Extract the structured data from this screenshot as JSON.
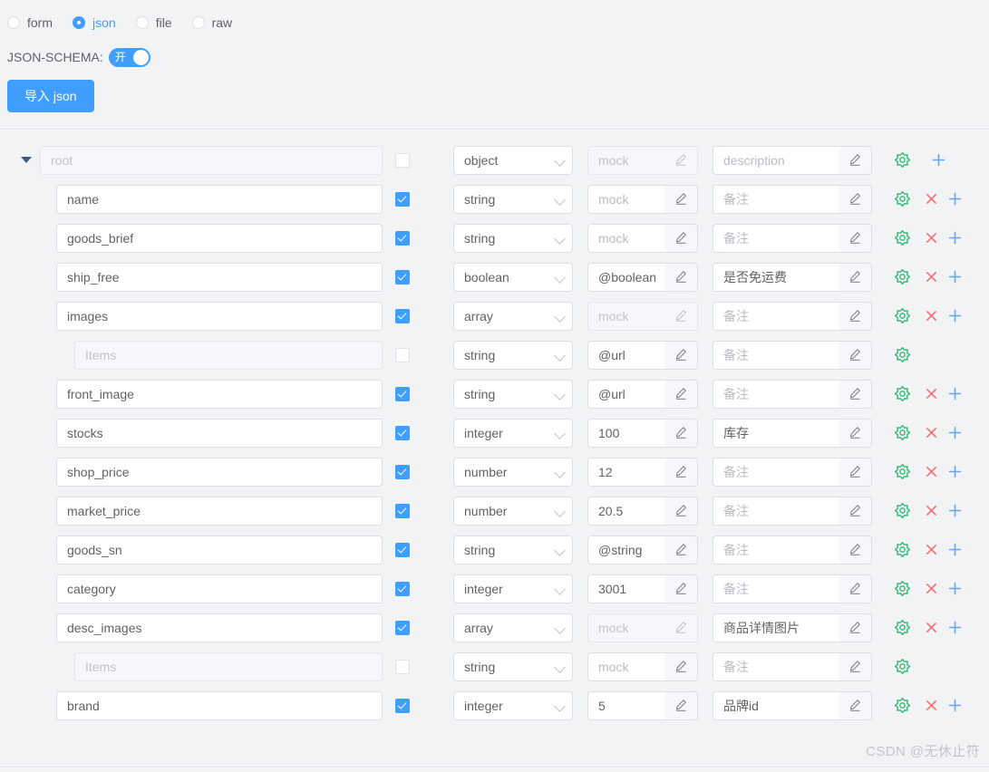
{
  "mode_radios": [
    {
      "label": "form",
      "checked": false
    },
    {
      "label": "json",
      "checked": true
    },
    {
      "label": "file",
      "checked": false
    },
    {
      "label": "raw",
      "checked": false
    }
  ],
  "schema_switch": {
    "caption": "JSON-SCHEMA:",
    "state_label": "开",
    "on": true,
    "on_color": "#409eff"
  },
  "import_button": {
    "label": "导入 json",
    "color": "#409eff"
  },
  "columns": {
    "type_options": [
      "object",
      "string",
      "number",
      "integer",
      "boolean",
      "array",
      "null"
    ],
    "mock_placeholder": "mock",
    "description_placeholder_root": "description",
    "description_placeholder_child": "备注"
  },
  "icons": {
    "caret": "caret-down-icon",
    "edit": "pencil-icon",
    "settings": "gear-icon",
    "remove": "close-icon",
    "add": "plus-icon",
    "gear_color": "#2eb872",
    "remove_color": "#f56c6c",
    "add_color": "#5fa8f5"
  },
  "rows": [
    {
      "level": "root",
      "key": "root",
      "key_is_placeholder": true,
      "checked": false,
      "checkbox_disabled": true,
      "type": "object",
      "mock": "",
      "mock_placeholder": "mock",
      "mock_disabled": true,
      "desc": "",
      "desc_placeholder": "description",
      "actions": [
        "gear",
        "plus"
      ],
      "caret": true
    },
    {
      "level": "child",
      "key": "name",
      "key_is_placeholder": false,
      "checked": true,
      "checkbox_disabled": false,
      "type": "string",
      "mock": "",
      "mock_placeholder": "mock",
      "mock_disabled": false,
      "desc": "",
      "desc_placeholder": "备注",
      "actions": [
        "gear",
        "close",
        "plus"
      ],
      "caret": false
    },
    {
      "level": "child",
      "key": "goods_brief",
      "key_is_placeholder": false,
      "checked": true,
      "checkbox_disabled": false,
      "type": "string",
      "mock": "",
      "mock_placeholder": "mock",
      "mock_disabled": false,
      "desc": "",
      "desc_placeholder": "备注",
      "actions": [
        "gear",
        "close",
        "plus"
      ],
      "caret": false
    },
    {
      "level": "child",
      "key": "ship_free",
      "key_is_placeholder": false,
      "checked": true,
      "checkbox_disabled": false,
      "type": "boolean",
      "mock": "@boolean",
      "mock_placeholder": "mock",
      "mock_disabled": false,
      "desc": "是否免运费",
      "desc_placeholder": "备注",
      "actions": [
        "gear",
        "close",
        "plus"
      ],
      "caret": false
    },
    {
      "level": "child",
      "key": "images",
      "key_is_placeholder": false,
      "checked": true,
      "checkbox_disabled": false,
      "type": "array",
      "mock": "",
      "mock_placeholder": "mock",
      "mock_disabled": true,
      "desc": "",
      "desc_placeholder": "备注",
      "actions": [
        "gear",
        "close",
        "plus"
      ],
      "caret": false
    },
    {
      "level": "items",
      "key": "",
      "key_placeholder": "Items",
      "key_is_placeholder": true,
      "checked": false,
      "checkbox_disabled": true,
      "type": "string",
      "mock": "@url",
      "mock_placeholder": "mock",
      "mock_disabled": false,
      "desc": "",
      "desc_placeholder": "备注",
      "actions": [
        "gear"
      ],
      "caret": false
    },
    {
      "level": "child",
      "key": "front_image",
      "key_is_placeholder": false,
      "checked": true,
      "checkbox_disabled": false,
      "type": "string",
      "mock": "@url",
      "mock_placeholder": "mock",
      "mock_disabled": false,
      "desc": "",
      "desc_placeholder": "备注",
      "actions": [
        "gear",
        "close",
        "plus"
      ],
      "caret": false
    },
    {
      "level": "child",
      "key": "stocks",
      "key_is_placeholder": false,
      "checked": true,
      "checkbox_disabled": false,
      "type": "integer",
      "mock": "100",
      "mock_placeholder": "mock",
      "mock_disabled": false,
      "desc": "库存",
      "desc_placeholder": "备注",
      "actions": [
        "gear",
        "close",
        "plus"
      ],
      "caret": false
    },
    {
      "level": "child",
      "key": "shop_price",
      "key_is_placeholder": false,
      "checked": true,
      "checkbox_disabled": false,
      "type": "number",
      "mock": "12",
      "mock_placeholder": "mock",
      "mock_disabled": false,
      "desc": "",
      "desc_placeholder": "备注",
      "actions": [
        "gear",
        "close",
        "plus"
      ],
      "caret": false
    },
    {
      "level": "child",
      "key": "market_price",
      "key_is_placeholder": false,
      "checked": true,
      "checkbox_disabled": false,
      "type": "number",
      "mock": "20.5",
      "mock_placeholder": "mock",
      "mock_disabled": false,
      "desc": "",
      "desc_placeholder": "备注",
      "actions": [
        "gear",
        "close",
        "plus"
      ],
      "caret": false
    },
    {
      "level": "child",
      "key": "goods_sn",
      "key_is_placeholder": false,
      "checked": true,
      "checkbox_disabled": false,
      "type": "string",
      "mock": "@string",
      "mock_placeholder": "mock",
      "mock_disabled": false,
      "desc": "",
      "desc_placeholder": "备注",
      "actions": [
        "gear",
        "close",
        "plus"
      ],
      "caret": false
    },
    {
      "level": "child",
      "key": "category",
      "key_is_placeholder": false,
      "checked": true,
      "checkbox_disabled": false,
      "type": "integer",
      "mock": "3001",
      "mock_placeholder": "mock",
      "mock_disabled": false,
      "desc": "",
      "desc_placeholder": "备注",
      "actions": [
        "gear",
        "close",
        "plus"
      ],
      "caret": false
    },
    {
      "level": "child",
      "key": "desc_images",
      "key_is_placeholder": false,
      "checked": true,
      "checkbox_disabled": false,
      "type": "array",
      "mock": "",
      "mock_placeholder": "mock",
      "mock_disabled": true,
      "desc": "商品详情图片",
      "desc_placeholder": "备注",
      "actions": [
        "gear",
        "close",
        "plus"
      ],
      "caret": false
    },
    {
      "level": "items",
      "key": "",
      "key_placeholder": "Items",
      "key_is_placeholder": true,
      "checked": false,
      "checkbox_disabled": true,
      "type": "string",
      "mock": "",
      "mock_placeholder": "mock",
      "mock_disabled": false,
      "desc": "",
      "desc_placeholder": "备注",
      "actions": [
        "gear"
      ],
      "caret": false
    },
    {
      "level": "child",
      "key": "brand",
      "key_is_placeholder": false,
      "checked": true,
      "checkbox_disabled": false,
      "type": "integer",
      "mock": "5",
      "mock_placeholder": "mock",
      "mock_disabled": false,
      "desc": "品牌id",
      "desc_placeholder": "备注",
      "actions": [
        "gear",
        "close",
        "plus"
      ],
      "caret": false
    }
  ],
  "watermark": "CSDN @无休止符"
}
